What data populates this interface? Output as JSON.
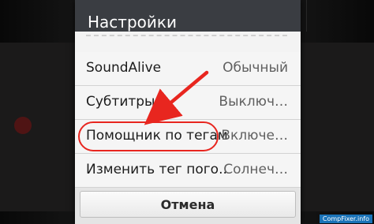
{
  "dialog": {
    "title": "Настройки",
    "items": [
      {
        "label": "SoundAlive",
        "value": "Обычный"
      },
      {
        "label": "Субтитры",
        "value": "Выключ…"
      },
      {
        "label": "Помощник по тегам",
        "value": "Включе…"
      },
      {
        "label": "Изменить тег пого..",
        "value": "Солнеч…"
      }
    ],
    "cancel_label": "Отмена"
  },
  "annotation": {
    "highlighted_item": "Помощник по тегам",
    "color": "#e8261f"
  },
  "watermark": "CompFixer.info",
  "colors": {
    "header_bg": "#3a3d42",
    "list_bg": "#f5f5f5",
    "accent_red": "#e8261f",
    "watermark_bg": "#1a73b8"
  }
}
